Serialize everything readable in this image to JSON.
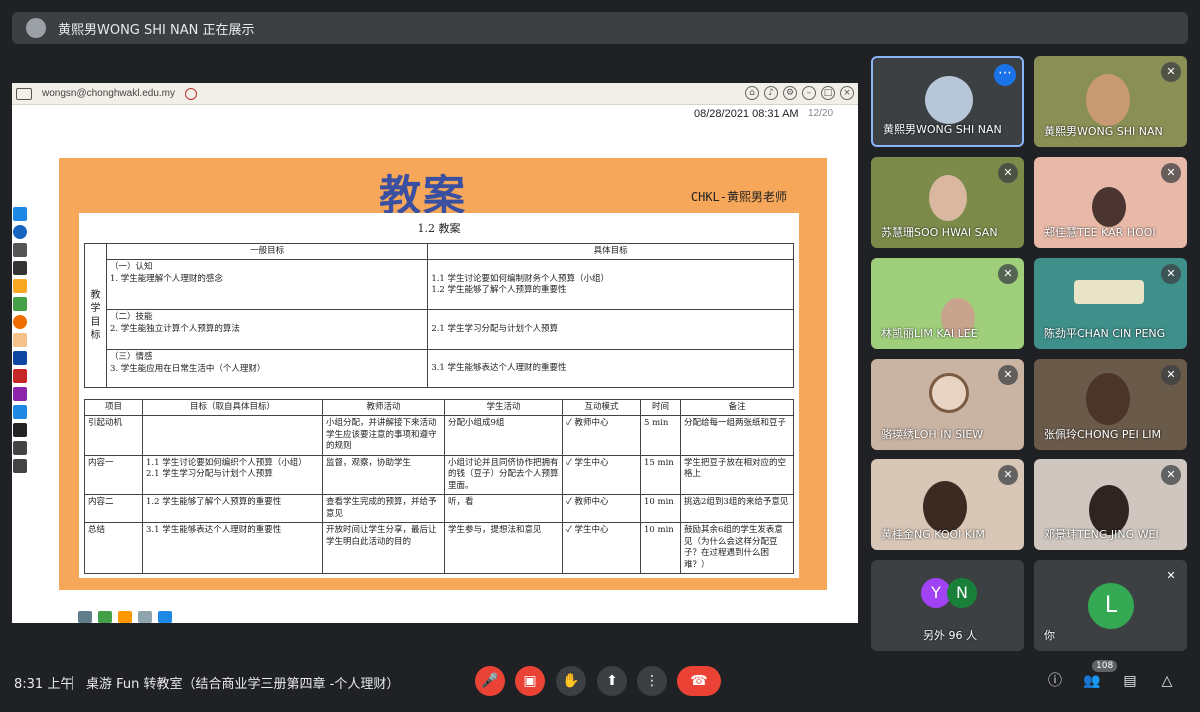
{
  "presenting": {
    "text": "黄熙男WONG SHI NAN 正在展示"
  },
  "classroom": {
    "email": "wongsn@chonghwakl.edu.my",
    "date": "08/28/2021 08:31 AM",
    "page": "12/20"
  },
  "slide": {
    "title": "教案",
    "author": "CHKL-黄熙男老师",
    "subtitle": "1.2 教案",
    "goals": {
      "header_general": "一般目标",
      "header_specific": "具体目标",
      "side_label": "教学目标",
      "rows": [
        {
          "general": "（一）认知\n1. 学生能理解个人理财的感念",
          "specific": "1.1 学生讨论要如何编制财务个人预算（小组）\n1.2 学生能够了解个人预算的重要性"
        },
        {
          "general": "（二）技能\n2. 学生能独立计算个人预算的算法",
          "specific": "2.1 学生学习分配与计划个人预算"
        },
        {
          "general": "（三）情感\n3. 学生能应用在日常生活中（个人理财）",
          "specific": "3.1 学生能够表达个人理财的重要性"
        }
      ]
    },
    "plan": {
      "headers": [
        "项目",
        "目标（取自具体目标）",
        "教师活动",
        "学生活动",
        "互动模式",
        "时间",
        "备注"
      ],
      "rows": [
        [
          "引起动机",
          "",
          "小组分配，并讲解接下来活动学生应该要注意的事项和遵守的规则",
          "分配小组成9组",
          "✓ 教师中心",
          "5 min",
          "分配给每一组两张纸和豆子"
        ],
        [
          "内容一",
          "1.1 学生讨论要如何编织个人预算（小组）\n2.1 学生学习分配与计划个人预算",
          "监督，观察，协助学生",
          "小组讨论并且同侪协作把拥有的钱（豆子）分配去个人预算里面。",
          "✓ 学生中心",
          "15 min",
          "学生把豆子放在相对应的空格上"
        ],
        [
          "内容二",
          "1.2 学生能够了解个人预算的重要性",
          "查看学生完成的预算，并给予意见",
          "听，看",
          "✓ 教师中心",
          "10 min",
          "挑选2组到3组的来给予意见"
        ],
        [
          "总结",
          "3.1 学生能够表达个人理财的重要性",
          "开放时间让学生分享，最后让学生明白此活动的目的",
          "学生参与，提想法和意见",
          "✓ 学生中心",
          "10 min",
          "鼓励其余6组的学生发表意见（为什么会这样分配豆子？在过程遇到什么困难？）"
        ]
      ]
    }
  },
  "participants": [
    {
      "name": "黄熙男WONG SHI NAN",
      "self": true
    },
    {
      "name": "黄熙男WONG SHI NAN"
    },
    {
      "name": "苏慧珊SOO HWAI SAN"
    },
    {
      "name": "郑佳慧TEE KAR HOOI"
    },
    {
      "name": "林凯丽LIM KAI LEE"
    },
    {
      "name": "陈劲平CHAN CIN PENG"
    },
    {
      "name": "骆瑛绣LOH IN SIEW"
    },
    {
      "name": "张佩玲CHONG PEI LIM"
    },
    {
      "name": "黄桂金NG KOOI KIM"
    },
    {
      "name": "邓景玮TENG JING WEI"
    }
  ],
  "others": {
    "label": "另外 96 人",
    "initials": [
      "Y",
      "N"
    ]
  },
  "you": {
    "label": "你",
    "initial": "L"
  },
  "bottom": {
    "time": "8:31 上午",
    "meeting": "桌游 Fun 转教室（结合商业学三册第四章 -个人理财）",
    "people_count": "108"
  },
  "colors": {
    "accent": "#8ab4f8",
    "danger": "#ea4335",
    "slide_bg": "#f6a75a"
  }
}
